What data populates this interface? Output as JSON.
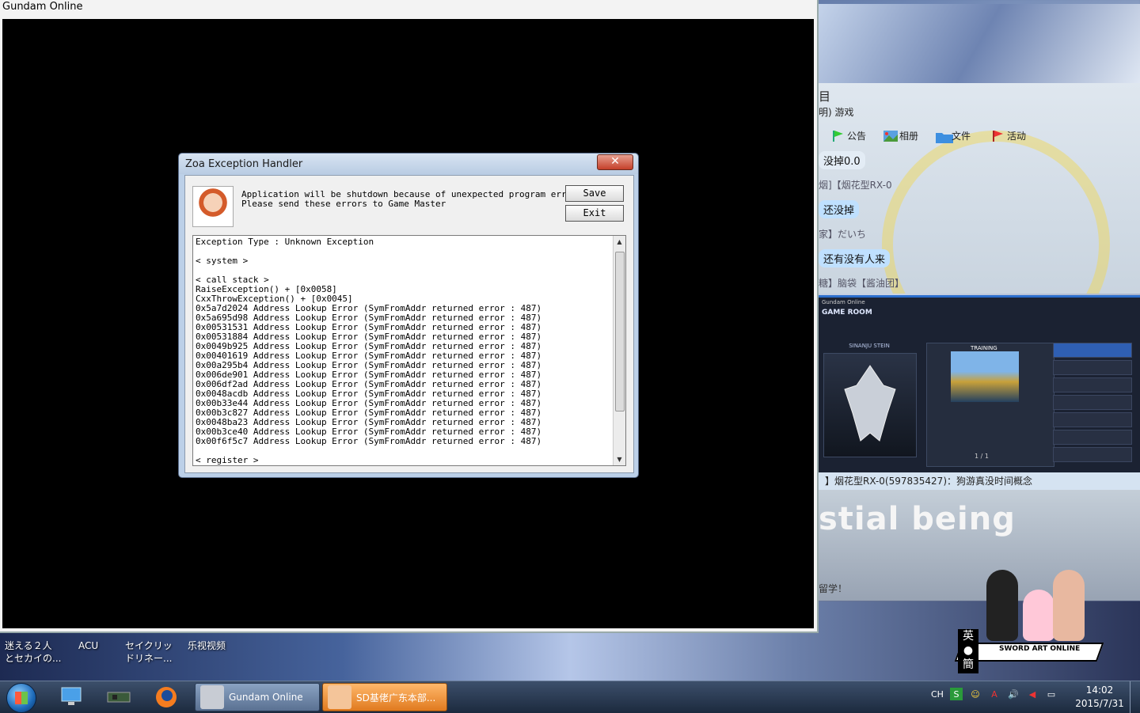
{
  "game_window": {
    "title": "Gundam Online"
  },
  "dialog": {
    "title": "Zoa Exception Handler",
    "close_label": "✕",
    "message": "Application will be shutdown because of unexpected program error.\nPlease send these errors to Game Master",
    "save_label": "Save",
    "exit_label": "Exit",
    "log": "Exception Type : Unknown Exception\n\n< system >\n\n< call stack >\nRaiseException() + [0x0058]\nCxxThrowException() + [0x0045]\n0x5a7d2024 Address Lookup Error (SymFromAddr returned error : 487)\n0x5a695d98 Address Lookup Error (SymFromAddr returned error : 487)\n0x00531531 Address Lookup Error (SymFromAddr returned error : 487)\n0x00531884 Address Lookup Error (SymFromAddr returned error : 487)\n0x0049b925 Address Lookup Error (SymFromAddr returned error : 487)\n0x00401619 Address Lookup Error (SymFromAddr returned error : 487)\n0x00a295b4 Address Lookup Error (SymFromAddr returned error : 487)\n0x006de901 Address Lookup Error (SymFromAddr returned error : 487)\n0x006df2ad Address Lookup Error (SymFromAddr returned error : 487)\n0x0048acdb Address Lookup Error (SymFromAddr returned error : 487)\n0x00b33e44 Address Lookup Error (SymFromAddr returned error : 487)\n0x00b3c827 Address Lookup Error (SymFromAddr returned error : 487)\n0x0048ba23 Address Lookup Error (SymFromAddr returned error : 487)\n0x00b3ce40 Address Lookup Error (SymFromAddr returned error : 487)\n0x00f6f5c7 Address Lookup Error (SymFromAddr returned error : 487)\n\n< register >"
  },
  "chat": {
    "header_fragment": "目",
    "subheader": "明) 游戏",
    "toolbar": [
      {
        "label": "公告",
        "icon": "flag-icon"
      },
      {
        "label": "相册",
        "icon": "photo-icon"
      },
      {
        "label": "文件",
        "icon": "folder-icon"
      },
      {
        "label": "活动",
        "icon": "flag-red-icon"
      }
    ],
    "messages": [
      {
        "text": "没掉0.0"
      },
      {
        "text": "烟]【烟花型RX-0"
      },
      {
        "text": "还没掉"
      },
      {
        "text": "家】だいち"
      },
      {
        "text": "还有没有人来"
      },
      {
        "text": "糖】脑袋【酱油团】"
      }
    ],
    "status_line": "】烟花型RX-0(597835427)：狗游真没时间概念",
    "banner_text": "stial being",
    "note": "留学！"
  },
  "gameroom": {
    "window_title": "Gundam Online",
    "header": "GAME ROOM",
    "mecha_name": "SINANJU STEIN",
    "training_label": "TRAINING",
    "page": "1 / 1"
  },
  "ime": {
    "top": "英",
    "bottom": "簡"
  },
  "sao_logo": "SWORD ART ONLINE",
  "desktop_icons": [
    {
      "label": "迷える２人\nとセカイの..."
    },
    {
      "label": "ACU"
    },
    {
      "label": "セイクリッ\nドリネー..."
    },
    {
      "label": "乐视视频"
    }
  ],
  "taskbar": {
    "tasks": [
      {
        "label": "Gundam Online"
      },
      {
        "label": "SD基佬广东本部..."
      }
    ],
    "tray_lang": "CH",
    "time": "14:02",
    "date": "2015/7/31"
  },
  "colors": {
    "dialog_frame": "#bcd0e8",
    "taskbar": "#1c2a3e",
    "close_button": "#c4402a"
  }
}
